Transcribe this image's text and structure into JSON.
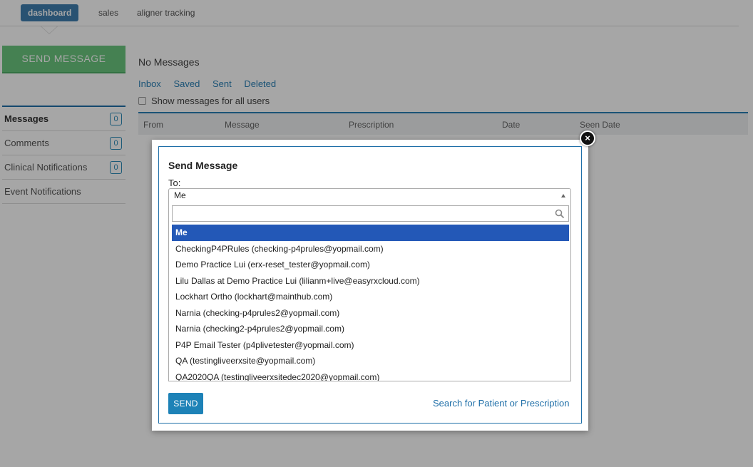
{
  "topnav": {
    "tabs": [
      {
        "label": "dashboard",
        "active": true
      },
      {
        "label": "sales",
        "active": false
      },
      {
        "label": "aligner tracking",
        "active": false
      }
    ]
  },
  "sidebar": {
    "send_message_label": "SEND MESSAGE",
    "items": [
      {
        "label": "Messages",
        "count": "0",
        "active": true
      },
      {
        "label": "Comments",
        "count": "0"
      },
      {
        "label": "Clinical Notifications",
        "count": "0"
      },
      {
        "label": "Event Notifications"
      }
    ]
  },
  "main": {
    "status_text": "No Messages",
    "folder_tabs": [
      "Inbox",
      "Saved",
      "Sent",
      "Deleted"
    ],
    "show_all_label": "Show messages for all users",
    "table_headers": [
      "From",
      "Message",
      "Prescription",
      "Date",
      "Seen Date"
    ]
  },
  "modal": {
    "title": "Send Message",
    "to_label": "To:",
    "selected_value": "Me",
    "search_placeholder": "",
    "options": [
      "Me",
      "CheckingP4PRules (checking-p4prules@yopmail.com)",
      "Demo Practice Lui (erx-reset_tester@yopmail.com)",
      "Lilu Dallas at Demo Practice Lui (lilianm+live@easyrxcloud.com)",
      "Lockhart Ortho (lockhart@mainthub.com)",
      "Narnia (checking-p4prules2@yopmail.com)",
      "Narnia (checking2-p4prules2@yopmail.com)",
      "P4P Email Tester (p4plivetester@yopmail.com)",
      "QA (testingliveerxsite@yopmail.com)",
      "QA2020QA (testingliveerxsitedec2020@yopmail.com)"
    ],
    "send_label": "SEND",
    "search_link_label": "Search for Patient or Prescription",
    "close_glyph": "×"
  },
  "colors": {
    "accent_blue": "#1f6fa8",
    "send_message_green": "#6ac77f",
    "selected_option": "#2358b7",
    "nav_active": "#3f7fb0"
  }
}
